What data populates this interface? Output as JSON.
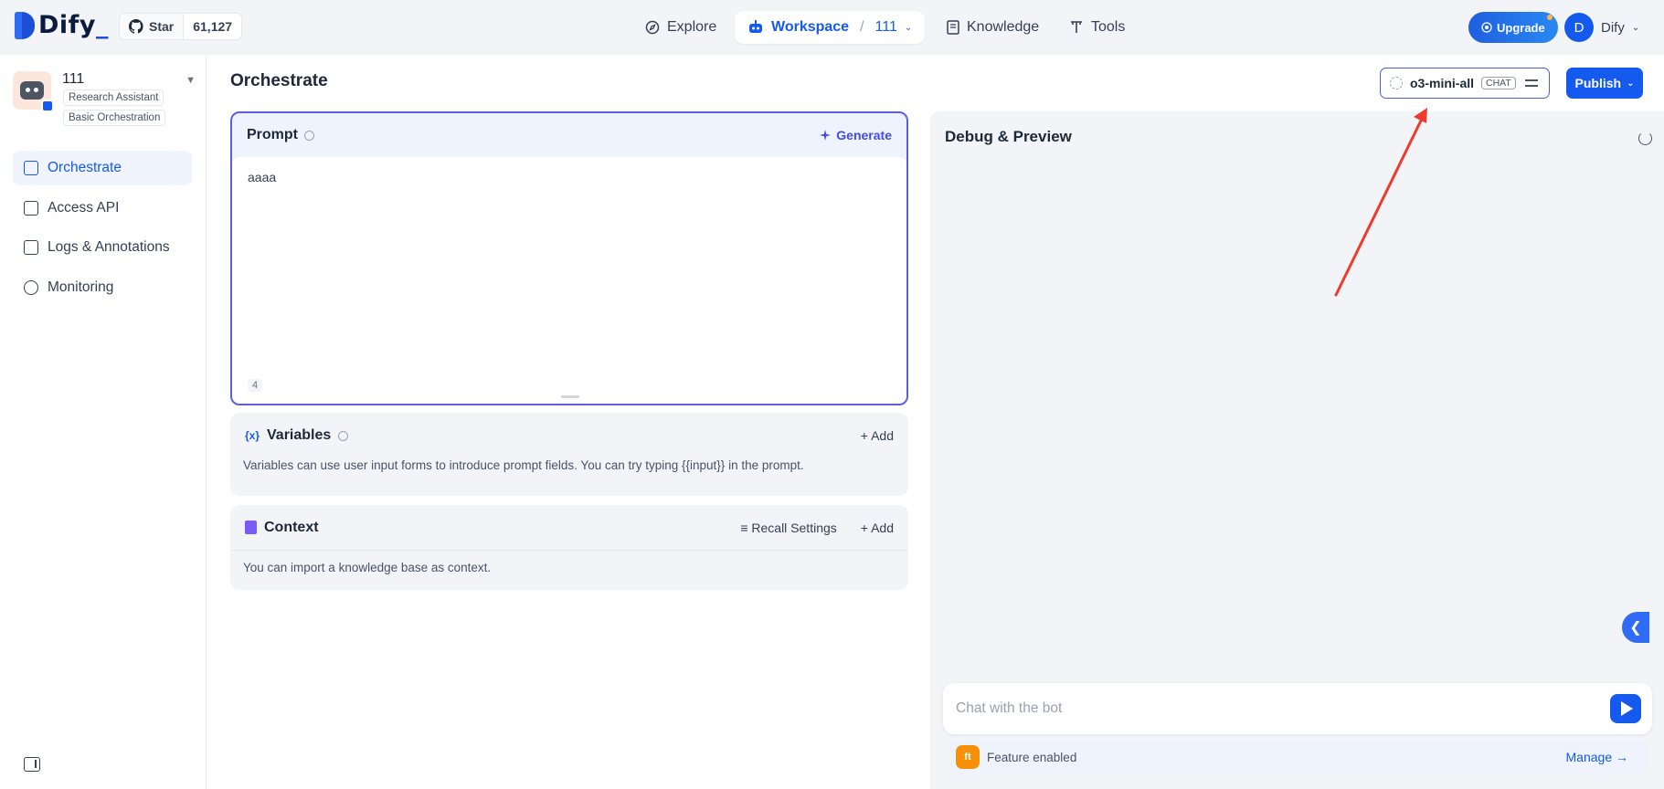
{
  "brand": {
    "logo_text": "Dify",
    "logo_underscore": "_"
  },
  "github": {
    "star_label": "Star",
    "star_count": "61,127"
  },
  "nav": {
    "explore": "Explore",
    "workspace": "Workspace",
    "workspace_sep": "/",
    "workspace_name": "111",
    "knowledge": "Knowledge",
    "tools": "Tools"
  },
  "upgrade": {
    "label": "Upgrade"
  },
  "user": {
    "initial": "D",
    "name": "Dify"
  },
  "app": {
    "name": "111",
    "tags": [
      "Research Assistant",
      "Basic Orchestration"
    ]
  },
  "sidebar": {
    "items": [
      {
        "label": "Orchestrate",
        "active": true
      },
      {
        "label": "Access API",
        "active": false
      },
      {
        "label": "Logs & Annotations",
        "active": false
      },
      {
        "label": "Monitoring",
        "active": false
      }
    ]
  },
  "main": {
    "title": "Orchestrate",
    "model": {
      "name": "o3-mini-all",
      "badge": "CHAT"
    },
    "publish_label": "Publish"
  },
  "prompt": {
    "title": "Prompt",
    "generate_label": "Generate",
    "text": "aaaa",
    "char_count": "4"
  },
  "variables": {
    "title": "Variables",
    "add_label": "Add",
    "description": "Variables can use user input forms to introduce prompt fields. You can try typing {{input}} in the prompt."
  },
  "context": {
    "title": "Context",
    "recall_label": "Recall Settings",
    "add_label": "Add",
    "description": "You can import a knowledge base as context."
  },
  "debug": {
    "title": "Debug & Preview",
    "chat_placeholder": "Chat with the bot",
    "feature_label": "Feature enabled",
    "manage_label": "Manage"
  },
  "colors": {
    "primary": "#155aef",
    "prompt_border": "#5b5fe0",
    "annotation_arrow": "#f03a2e"
  }
}
